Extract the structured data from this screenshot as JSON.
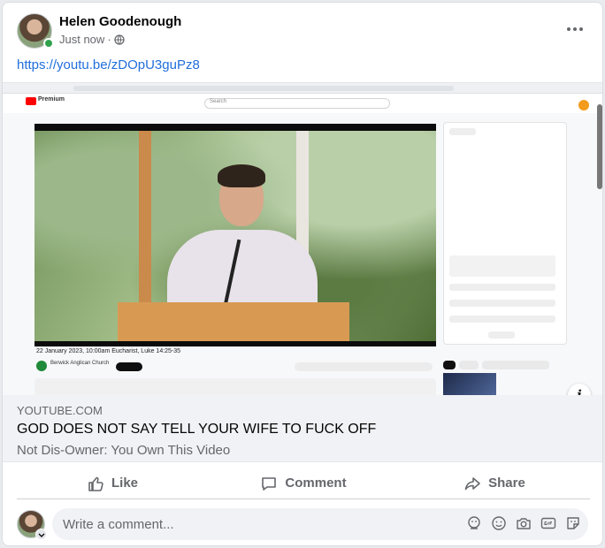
{
  "post": {
    "author": "Helen Goodenough",
    "timestamp": "Just now",
    "separator": "·",
    "privacy_icon": "globe-icon",
    "link_text": "https://youtu.be/zDOpU3guPz8"
  },
  "preview": {
    "yt_brand": "Premium",
    "yt_search_placeholder": "Search",
    "video_title": "22 January 2023, 10:00am Eucharist, Luke 14:25-35",
    "channel_name": "Berwick Anglican Church",
    "info_icon": "i"
  },
  "link_card": {
    "domain": "YOUTUBE.COM",
    "headline": "GOD DOES NOT SAY TELL YOUR WIFE TO FUCK OFF",
    "subline": "Not Dis-Owner: You Own This Video"
  },
  "actions": {
    "like": "Like",
    "comment": "Comment",
    "share": "Share"
  },
  "comment_box": {
    "placeholder": "Write a comment..."
  },
  "colors": {
    "link": "#216fdb",
    "online": "#31a24c",
    "muted": "#65676b"
  }
}
